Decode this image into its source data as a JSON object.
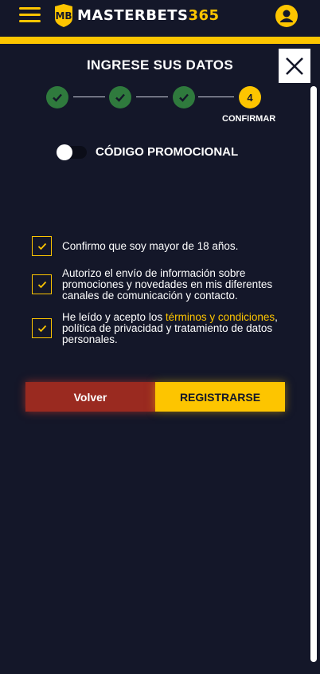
{
  "header": {
    "logo_letters": "MB",
    "logo_text_white": "MASTERBETS",
    "logo_text_yellow": "365",
    "menu_icon": "hamburger-menu-icon",
    "user_icon": "user-icon"
  },
  "modal": {
    "close_icon": "close-icon",
    "title": "INGRESE SUS DATOS",
    "steps": [
      {
        "state": "done",
        "icon": "check-icon"
      },
      {
        "state": "done",
        "icon": "check-icon"
      },
      {
        "state": "done",
        "icon": "check-icon"
      },
      {
        "state": "current",
        "number": "4"
      }
    ],
    "current_step_label": "CONFIRMAR",
    "promo_toggle_label": "CÓDIGO PROMOCIONAL",
    "checkboxes": [
      {
        "checked": true,
        "text": "Confirmo que soy mayor de 18 años."
      },
      {
        "checked": true,
        "text": "Autorizo el envío de información sobre promociones y novedades en mis diferentes canales de comunicación y contacto."
      },
      {
        "checked": true,
        "text_before": "He leído y acepto los ",
        "link": "términos y condiciones",
        "text_after": ", política de privacidad y tratamiento de datos personales."
      }
    ],
    "back_button": "Volver",
    "register_button": "REGISTRARSE"
  },
  "colors": {
    "background": "#141729",
    "accent": "#fdc500",
    "step_done": "#2f7a3d",
    "back_button": "#9a2a20"
  }
}
